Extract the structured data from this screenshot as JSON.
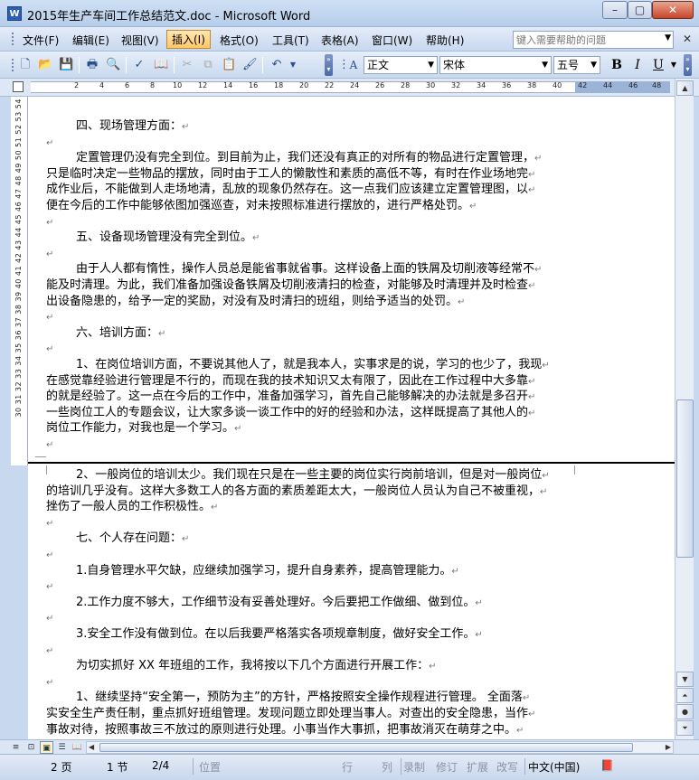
{
  "window": {
    "title": "2015年生产车间工作总结范文.doc - Microsoft Word",
    "app_icon": "W",
    "min_label": "–",
    "max_label": "▢",
    "close_label": "✕"
  },
  "menu": {
    "items": [
      "文件(F)",
      "编辑(E)",
      "视图(V)",
      "插入(I)",
      "格式(O)",
      "工具(T)",
      "表格(A)",
      "窗口(W)",
      "帮助(H)"
    ],
    "active": "插入(I)",
    "help_placeholder": "键入需要帮助的问题"
  },
  "toolbar": {
    "style": "正文",
    "font": "宋体",
    "size": "五号",
    "bold": "B",
    "italic": "I",
    "underline": "U",
    "style_icon": "A"
  },
  "ruler": {
    "ticks": [
      "2",
      "4",
      "6",
      "8",
      "10",
      "12",
      "14",
      "16",
      "18",
      "20",
      "22",
      "24",
      "26",
      "28",
      "30",
      "32",
      "34",
      "36",
      "38",
      "40",
      "42",
      "44",
      "46",
      "48"
    ],
    "vertical_text": "30 31 32 33 34 35 36 37 38 39 40 41 42 43 44 45 46 47 48 49 50 51 52 53 54"
  },
  "document": {
    "lines": [
      {
        "text": "四、现场管理方面：",
        "indent": true
      },
      {
        "text": "",
        "indent": false
      },
      {
        "text": "定置管理仍没有完全到位。到目前为止，我们还没有真正的对所有的物品进行定置管理，",
        "indent": true
      },
      {
        "text": "只是临时决定一些物品的摆放，同时由于工人的懒散性和素质的高低不等，有时在作业场地完",
        "indent": false
      },
      {
        "text": "成作业后，不能做到人走场地清，乱放的现象仍然存在。这一点我们应该建立定置管理图，以",
        "indent": false
      },
      {
        "text": "便在今后的工作中能够依图加强巡查，对未按照标准进行摆放的，进行严格处罚。",
        "indent": false
      },
      {
        "text": "",
        "indent": false
      },
      {
        "text": "五、设备现场管理没有完全到位。",
        "indent": true
      },
      {
        "text": "",
        "indent": false
      },
      {
        "text": "由于人人都有惰性，操作人员总是能省事就省事。这样设备上面的铁屑及切削液等经常不",
        "indent": true
      },
      {
        "text": "能及时清理。为此，我们准备加强设备铁屑及切削液清扫的检查，对能够及时清理并及时检查",
        "indent": false
      },
      {
        "text": "出设备隐患的，给予一定的奖励，对没有及时清扫的班组，则给予适当的处罚。",
        "indent": false
      },
      {
        "text": "",
        "indent": false
      },
      {
        "text": "六、培训方面：",
        "indent": true
      },
      {
        "text": "",
        "indent": false
      },
      {
        "text": "1、在岗位培训方面，不要说其他人了，就是我本人，实事求是的说，学习的也少了，我现",
        "indent": true
      },
      {
        "text": "在感觉靠经验进行管理是不行的，而现在我的技术知识又太有限了，因此在工作过程中大多靠",
        "indent": false
      },
      {
        "text": "的就是经验了。这一点在今后的工作中，准备加强学习，首先自己能够解决的办法就是多召开",
        "indent": false
      },
      {
        "text": "一些岗位工人的专题会议，让大家多谈一谈工作中的好的经验和办法，这样既提高了其他人的",
        "indent": false
      },
      {
        "text": "岗位工作能力，对我也是一个学习。",
        "indent": false
      },
      {
        "text": "",
        "indent": false
      }
    ],
    "lines2": [
      {
        "text": "2、一般岗位的培训太少。我们现在只是在一些主要的岗位实行岗前培训，但是对一般岗位",
        "indent": true
      },
      {
        "text": "的培训几乎没有。这样大多数工人的各方面的素质差距太大，一般岗位人员认为自己不被重视，",
        "indent": false
      },
      {
        "text": "挫伤了一般人员的工作积极性。",
        "indent": false
      },
      {
        "text": "",
        "indent": false
      },
      {
        "text": "七、个人存在问题：",
        "indent": true
      },
      {
        "text": "",
        "indent": false
      },
      {
        "text": "1.自身管理水平欠缺，应继续加强学习，提升自身素养，提高管理能力。",
        "indent": true
      },
      {
        "text": "",
        "indent": false
      },
      {
        "text": "2.工作力度不够大，工作细节没有妥善处理好。今后要把工作做细、做到位。",
        "indent": true
      },
      {
        "text": "",
        "indent": false
      },
      {
        "text": "3.安全工作没有做到位。在以后我要严格落实各项规章制度，做好安全工作。",
        "indent": true
      },
      {
        "text": "",
        "indent": false
      },
      {
        "text": "为切实抓好 XX 年班组的工作，我将按以下几个方面进行开展工作：",
        "indent": true
      },
      {
        "text": "",
        "indent": false
      },
      {
        "text": "1、继续坚持“安全第一，预防为主”的方针，严格按照安全操作规程进行管理。 全面落",
        "indent": true
      },
      {
        "text": "实安全生产责任制，重点抓好班组管理。发现问题立即处理当事人。对查出的安全隐患，当作",
        "indent": false
      },
      {
        "text": "事故对待，按照事故三不放过的原则进行处理。小事当作大事抓，把事故消灭在萌芽之中。",
        "indent": false
      }
    ],
    "paragraph_mark": "↵"
  },
  "status": {
    "page": "2 页",
    "section": "1 节",
    "page_of": "2/4",
    "position": "位置",
    "line": "行",
    "column": "列",
    "rec": "录制",
    "trk": "修订",
    "ext": "扩展",
    "ovr": "改写",
    "language": "中文(中国)"
  }
}
